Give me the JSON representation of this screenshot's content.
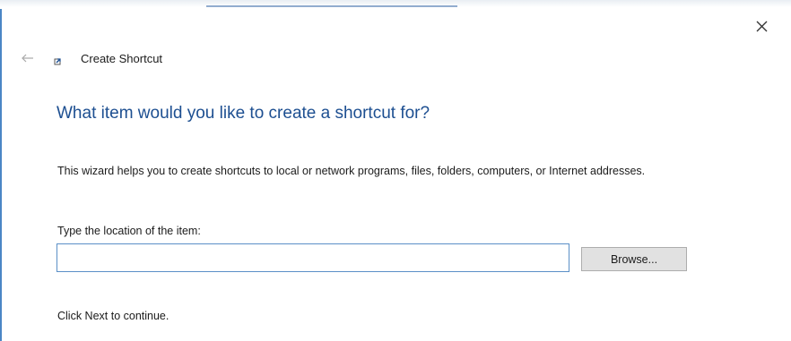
{
  "window": {
    "title": "Create Shortcut",
    "close_icon": "close-icon",
    "back_icon": "back-arrow-icon",
    "app_icon": "shortcut-wizard-icon"
  },
  "main": {
    "heading": "What item would you like to create a shortcut for?",
    "description": "This wizard helps you to create shortcuts to local or network programs, files, folders, computers, or Internet addresses.",
    "location_label": "Type the location of the item:",
    "location_value": "",
    "browse_label": "Browse...",
    "footer_note": "Click Next to continue."
  },
  "colors": {
    "heading": "#1d4f91",
    "input_border": "#5b8fc7",
    "button_bg": "#e1e1e1"
  }
}
